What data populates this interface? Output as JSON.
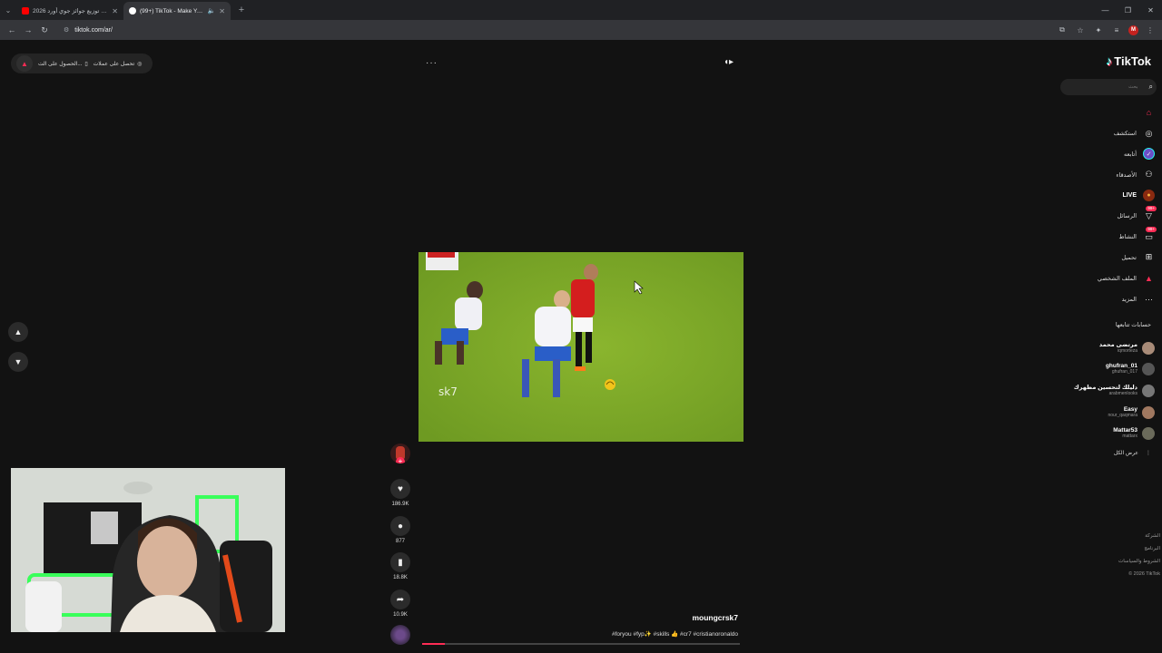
{
  "browser": {
    "tabs": [
      {
        "title": "حفل توزيع جوائز جوي أورد 2026",
        "active": false,
        "favicon_color": "#ff0000"
      },
      {
        "title": "(99+) TikTok - Make Your D...",
        "active": true,
        "favicon_color": "#ffffff"
      }
    ],
    "url": "tiktok.com/ar/",
    "new_tab_label": "+",
    "profile_letter": "M"
  },
  "top_bar": {
    "get_coins": "تحصل على عملات",
    "get_app": "الحصول على الت...",
    "more": "···"
  },
  "video": {
    "watermark": "sk7",
    "progress": 0.07
  },
  "actions": {
    "likes": "186.9K",
    "comments": "877",
    "saves": "18.8K",
    "shares": "10.9K"
  },
  "caption": {
    "author": "moungcrsk7",
    "tags": "#foryou #fyp✨ #skills 👍 #cr7 #cristianoronaldo"
  },
  "sidebar": {
    "logo": "TikTok",
    "search_placeholder": "بحث",
    "nav": [
      {
        "label": "",
        "icon": "home-icon",
        "active": true
      },
      {
        "label": "استكشف",
        "icon": "compass-icon"
      },
      {
        "label": "أتابعه",
        "icon": "following-icon"
      },
      {
        "label": "الأصدقاء",
        "icon": "friends-icon"
      },
      {
        "label": "LIVE",
        "icon": "live-icon"
      },
      {
        "label": "الرسائل",
        "icon": "messages-icon",
        "badge": "99+"
      },
      {
        "label": "النشاط",
        "icon": "activity-icon",
        "badge": "99+"
      },
      {
        "label": "تحميل",
        "icon": "upload-icon"
      },
      {
        "label": "الملف الشخصي",
        "icon": "profile-icon"
      },
      {
        "label": "المزيد",
        "icon": "more-icon"
      }
    ],
    "following_title": "حسابات تتابعها",
    "following": [
      {
        "name": "مرتضى محمد",
        "username": "iqmorteza",
        "color": "#a88b78"
      },
      {
        "name": "ghufran_01",
        "username": "ghufran_017",
        "color": "#555555"
      },
      {
        "name": "دليلك لتحسين مظهرك",
        "username": "arabmenlooks",
        "color": "#777777"
      },
      {
        "name": "Easy",
        "username": "nour_qaqmara",
        "color": "#a07860"
      },
      {
        "name": "Mattar53",
        "username": "mattarx",
        "color": "#6a6a5a"
      }
    ],
    "see_all": "عرض الكل",
    "footer": [
      "الشركة",
      "البرنامج",
      "الشروط والسياسات",
      "© 2026 TikTok"
    ]
  }
}
